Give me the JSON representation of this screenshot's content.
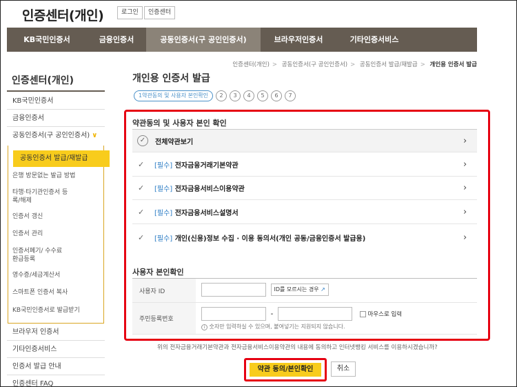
{
  "header": {
    "brand": "인증센터(개인)",
    "login": "로그인",
    "cert_center": "인증센터"
  },
  "nav": [
    {
      "label": "KB국민인증서",
      "active": false
    },
    {
      "label": "금융인증서",
      "active": false
    },
    {
      "label": "공동인증서(구 공인인증서)",
      "active": true
    },
    {
      "label": "브라우저인증서",
      "active": false
    },
    {
      "label": "기타인증서비스",
      "active": false
    }
  ],
  "breadcrumb": [
    "인증센터(개인)",
    "공동인증서(구 공인인증서)",
    "공동인증서 발급/재발급",
    "개인용 인증서 발급"
  ],
  "sidebar": {
    "title": "인증센터(개인)",
    "items": [
      "KB국민인증서",
      "금융인증서",
      "공동인증서(구 공인인증서)"
    ],
    "sub_items": [
      "공동인증서 발급/재발급",
      "은행 방문없는 발급 방법",
      "타행·타기관인증서 등록/해제",
      "인증서 갱신",
      "인증서 관리",
      "인증서폐기/ 수수료환급등록",
      "영수증/세금계산서",
      "스마트폰 인증서 복사",
      "KB국민인증서로 발급받기"
    ],
    "bottom_items": [
      "브라우저 인증서",
      "기타인증서비스",
      "인증서 발급 안내",
      "인증센터 FAQ"
    ]
  },
  "main": {
    "title": "개인용 인증서 발급",
    "step1": "1약관동의 및 사용자 본인확인",
    "steps": [
      "2",
      "3",
      "4",
      "5",
      "6",
      "7"
    ],
    "terms_title": "약관동의 및 사용자 본인 확인",
    "view_all": "전체약관보기",
    "required_tag": "[필수]",
    "terms": [
      "전자금융거래기본약관",
      "전자금융서비스이용약관",
      "전자금융서비스설명서",
      "개인(신용)정보 수집 · 이용 동의서(개인 공동/금융인증서 발급용)"
    ],
    "identity_title": "사용자 본인확인",
    "user_id_label": "사용자 ID",
    "forgot_id": "ID를 모르시는 경우",
    "rrn_label": "주민등록번호",
    "rrn_dash": "-",
    "mouse_input": "마우스로 입력",
    "rrn_hint": "숫자만 입력하실 수 있으며, 붙여넣기는 지원되지 않습니다.",
    "notice": "위의 전자금융거래기본약관과 전자금융서비스이용약관의 내용에 동의하고 인터넷뱅킹 서비스를 이용하시겠습니까?",
    "agree_button": "약관 동의/본인확인",
    "cancel_button": "취소"
  }
}
